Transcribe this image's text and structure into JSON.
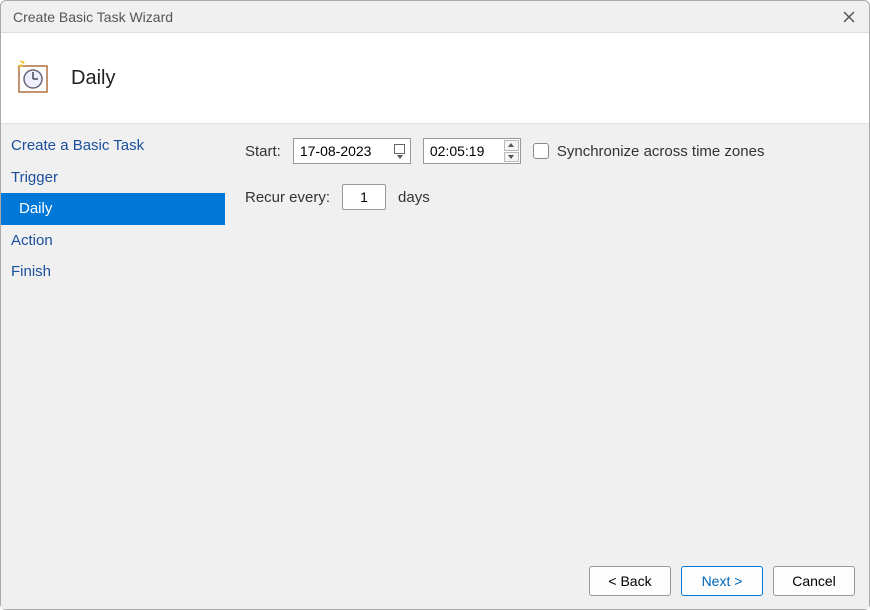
{
  "window": {
    "title": "Create Basic Task Wizard"
  },
  "header": {
    "title": "Daily"
  },
  "sidebar": {
    "items": [
      {
        "label": "Create a Basic Task",
        "selected": false,
        "indent": false
      },
      {
        "label": "Trigger",
        "selected": false,
        "indent": false
      },
      {
        "label": "Daily",
        "selected": true,
        "indent": true
      },
      {
        "label": "Action",
        "selected": false,
        "indent": false
      },
      {
        "label": "Finish",
        "selected": false,
        "indent": false
      }
    ]
  },
  "form": {
    "start_label": "Start:",
    "start_date": "17-08-2023",
    "start_time": "02:05:19",
    "sync_label": "Synchronize across time zones",
    "sync_checked": false,
    "recur_label": "Recur every:",
    "recur_value": "1",
    "recur_unit": "days"
  },
  "footer": {
    "back": "< Back",
    "next": "Next >",
    "cancel": "Cancel"
  }
}
